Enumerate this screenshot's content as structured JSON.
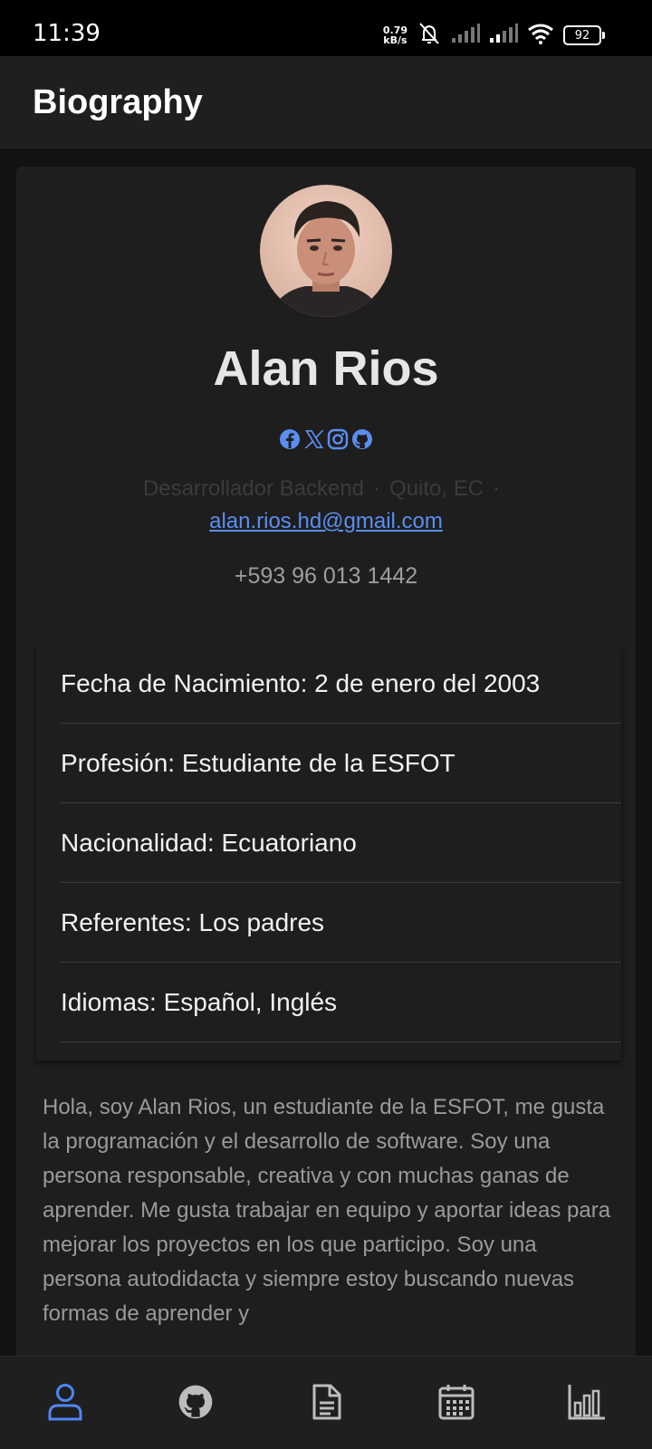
{
  "status_bar": {
    "time": "11:39",
    "net_speed_value": "0.79",
    "net_speed_unit": "kB/s",
    "battery": "92"
  },
  "app_bar": {
    "title": "Biography"
  },
  "profile": {
    "name": "Alan Rios",
    "role": "Desarrollador Backend",
    "location": "Quito, EC",
    "separator": "·",
    "email": "alan.rios.hd@gmail.com",
    "phone": "+593 96 013 1442",
    "socials": [
      "facebook-icon",
      "x-icon",
      "instagram-icon",
      "github-icon"
    ],
    "accent_color": "#5b8ef2"
  },
  "info": [
    "Fecha de Nacimiento: 2 de enero del 2003",
    "Profesión: Estudiante de la ESFOT",
    "Nacionalidad: Ecuatoriano",
    "Referentes: Los padres",
    "Idiomas: Español, Inglés"
  ],
  "bio_text": "Hola, soy Alan Rios, un estudiante de la ESFOT, me gusta la programación y el desarrollo de software. Soy una persona responsable, creativa y con muchas ganas de aprender. Me gusta trabajar en equipo y aportar ideas para mejorar los proyectos en los que participo. Soy una persona autodidacta y siempre estoy buscando nuevas formas de aprender y",
  "bottom_nav": {
    "items": [
      "person-icon",
      "github-icon",
      "document-icon",
      "calendar-icon",
      "bar-chart-icon"
    ],
    "active_index": 0,
    "active_color": "#4f86f7",
    "inactive_color": "#bdbdbd"
  }
}
